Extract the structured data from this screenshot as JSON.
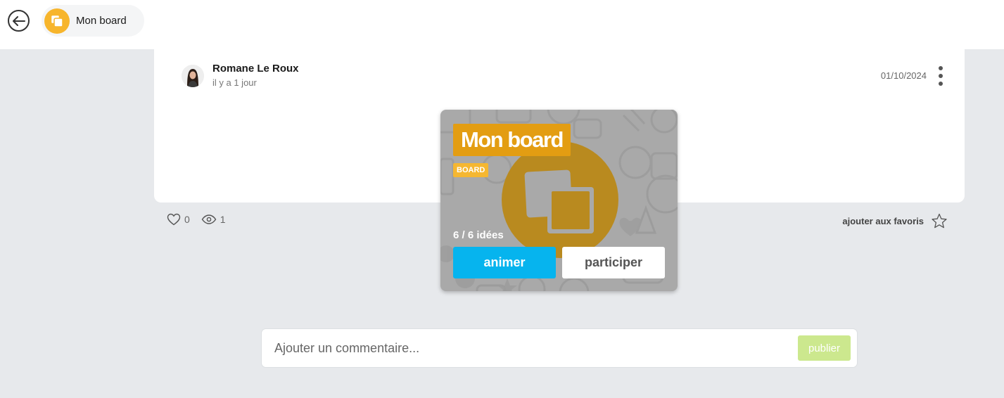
{
  "colors": {
    "page_bg": "#e7e9ec",
    "brand_yellow": "#f7b52c",
    "title_orange": "#e39d12",
    "animer_blue": "#06b4ee",
    "publish_green": "#cce88e"
  },
  "header": {
    "back_icon": "arrow-left-icon",
    "breadcrumb_icon": "board-icon",
    "breadcrumb_label": "Mon board"
  },
  "post": {
    "author": "Romane Le Roux",
    "relative_time": "il y a 1 jour",
    "date": "01/10/2024",
    "more_icon": "more-vertical-icon"
  },
  "board": {
    "title": "Mon board",
    "tag": "BOARD",
    "ideas_count": "6 / 6 idées",
    "animate_label": "animer",
    "participate_label": "participer"
  },
  "stats": {
    "likes": "0",
    "views": "1",
    "like_icon": "heart-icon",
    "view_icon": "eye-icon"
  },
  "favorites": {
    "label": "ajouter aux favoris",
    "icon": "star-icon"
  },
  "comment": {
    "placeholder": "Ajouter un commentaire...",
    "publish_label": "publier"
  }
}
